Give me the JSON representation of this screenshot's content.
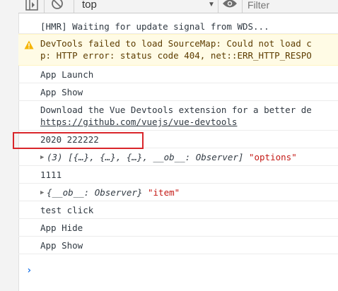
{
  "toolbar": {
    "context_value": "top",
    "filter_placeholder": "Filter",
    "icons": [
      "sidebar-toggle-icon",
      "clear-console-icon",
      "eye-icon"
    ]
  },
  "messages": [
    {
      "kind": "log",
      "text": "[HMR] Waiting for update signal from WDS..."
    },
    {
      "kind": "warning",
      "line1": "DevTools failed to load SourceMap: Could not load c",
      "line2": "p: HTTP error: status code 404, net::ERR_HTTP_RESPO"
    },
    {
      "kind": "log",
      "text": "App Launch"
    },
    {
      "kind": "log",
      "text": "App Show"
    },
    {
      "kind": "log",
      "line1": "Download the Vue Devtools extension for a better de",
      "link": "https://github.com/vuejs/vue-devtools"
    },
    {
      "kind": "log",
      "text": "2020 222222"
    },
    {
      "kind": "object",
      "obj": "(3) [{…}, {…}, {…}, __ob__: Observer]",
      "str": "\"options\""
    },
    {
      "kind": "log",
      "text": "1111"
    },
    {
      "kind": "object",
      "obj": "{__ob__: Observer}",
      "str": "\"item\""
    },
    {
      "kind": "log",
      "text": "test click"
    },
    {
      "kind": "log",
      "text": "App Hide"
    },
    {
      "kind": "log",
      "text": "App Show"
    }
  ],
  "prompt_symbol": "›",
  "colors": {
    "warning_bg": "#fffbe5",
    "string": "#c41a16",
    "highlight_box": "#d9262b",
    "prompt": "#1a73e8"
  }
}
